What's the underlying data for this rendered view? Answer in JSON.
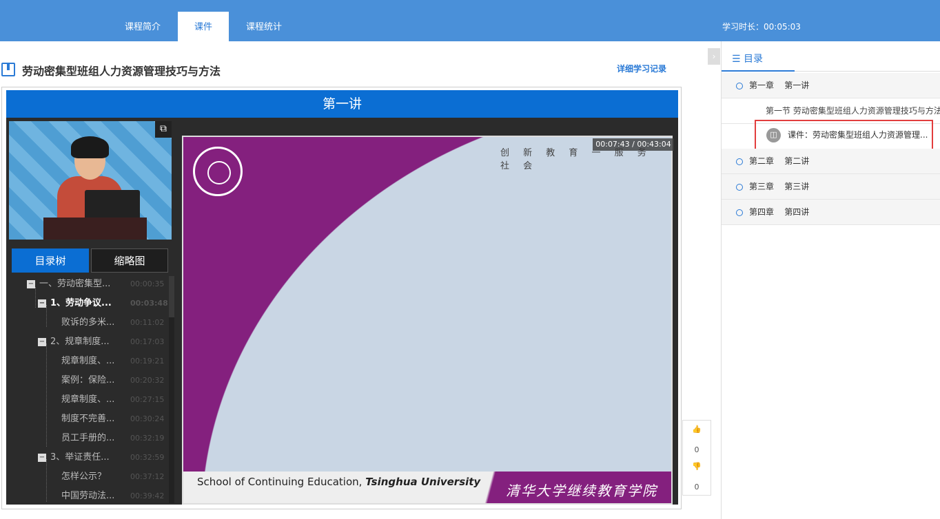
{
  "tabs": [
    "课程简介",
    "课件",
    "课程统计"
  ],
  "study_time": "学习时长：00:05:03",
  "course_title": "劳动密集型班组人力资源管理技巧与方法",
  "record_link": "详细学习记录",
  "player": {
    "lecture_title": "第一讲",
    "tab_tree": "目录树",
    "tab_thumbs": "缩略图",
    "time_display": "00:07:43 / 00:43:04",
    "slide_motto": "创 新 教 育 一 服 务 社 会",
    "slide_school_en_prefix": "School of Continuing Education, ",
    "slide_school_en_name": "Tsinghua University",
    "slide_school_cn": "清华大学继续教育学院",
    "tree": [
      {
        "label": "一、劳动密集型...",
        "time": "00:00:35"
      },
      {
        "label": "1、劳动争议...",
        "time": "00:03:48"
      },
      {
        "label": "败诉的多米...",
        "time": "00:11:02"
      },
      {
        "label": "2、规章制度...",
        "time": "00:17:03"
      },
      {
        "label": "规章制度、...",
        "time": "00:19:21"
      },
      {
        "label": "案例：保险...",
        "time": "00:20:32"
      },
      {
        "label": "规章制度、...",
        "time": "00:27:15"
      },
      {
        "label": "制度不完善...",
        "time": "00:30:24"
      },
      {
        "label": "员工手册的...",
        "time": "00:32:19"
      },
      {
        "label": "3、举证责任...",
        "time": "00:32:59"
      },
      {
        "label": "怎样公示？",
        "time": "00:37:12"
      },
      {
        "label": "中国劳动法...",
        "time": "00:39:42"
      }
    ]
  },
  "votes": {
    "up": "0",
    "down": "0"
  },
  "sidebar": {
    "tab": "目录",
    "chapters": [
      {
        "num": "第一章",
        "name": "第一讲"
      },
      {
        "num": "第二章",
        "name": "第二讲"
      },
      {
        "num": "第三章",
        "name": "第三讲"
      },
      {
        "num": "第四章",
        "name": "第四讲"
      }
    ],
    "section": "第一节 劳动密集型班组人力资源管理技巧与方法",
    "courseware": "课件：劳动密集型班组人力资源管理..."
  },
  "colors": {
    "accent": "#4a90d9",
    "player_blue": "#0b6ed3",
    "highlight": "#e23d3d",
    "slide_purple": "#84207e"
  }
}
